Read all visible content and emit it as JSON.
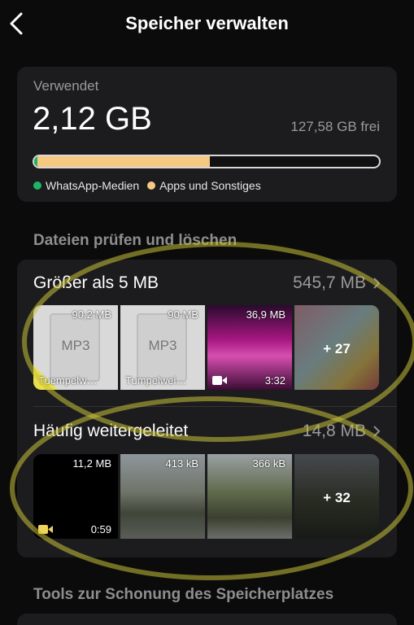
{
  "header": {
    "title": "Speicher verwalten",
    "back_icon": "chevron-left-icon"
  },
  "usage": {
    "label": "Verwendet",
    "used": "2,12 GB",
    "free": "127,58 GB frei",
    "bar": {
      "whatsapp_fraction": 0.01,
      "apps_fraction": 0.5
    },
    "legend": [
      {
        "label": "WhatsApp-Medien",
        "color": "#1fb463"
      },
      {
        "label": "Apps und Sonstiges",
        "color": "#f6c983"
      }
    ]
  },
  "section_review": "Dateien prüfen und löschen",
  "larger": {
    "title": "Größer als 5 MB",
    "total": "545,7 MB",
    "items": [
      {
        "size": "90,2 MB",
        "label": "MP3",
        "name": "Tuempelw…"
      },
      {
        "size": "90 MB",
        "label": "MP3",
        "name": "Tumpelwei…"
      },
      {
        "size": "36,9 MB",
        "duration": "3:32"
      },
      {
        "more": "+ 27"
      }
    ]
  },
  "forwarded": {
    "title": "Häufig weitergeleitet",
    "total": "14,8 MB",
    "items": [
      {
        "size": "11,2 MB",
        "duration": "0:59"
      },
      {
        "size": "413 kB"
      },
      {
        "size": "366 kB"
      },
      {
        "more": "+ 32"
      }
    ]
  },
  "section_tools": "Tools zur Schonung des Speicherplatzes"
}
